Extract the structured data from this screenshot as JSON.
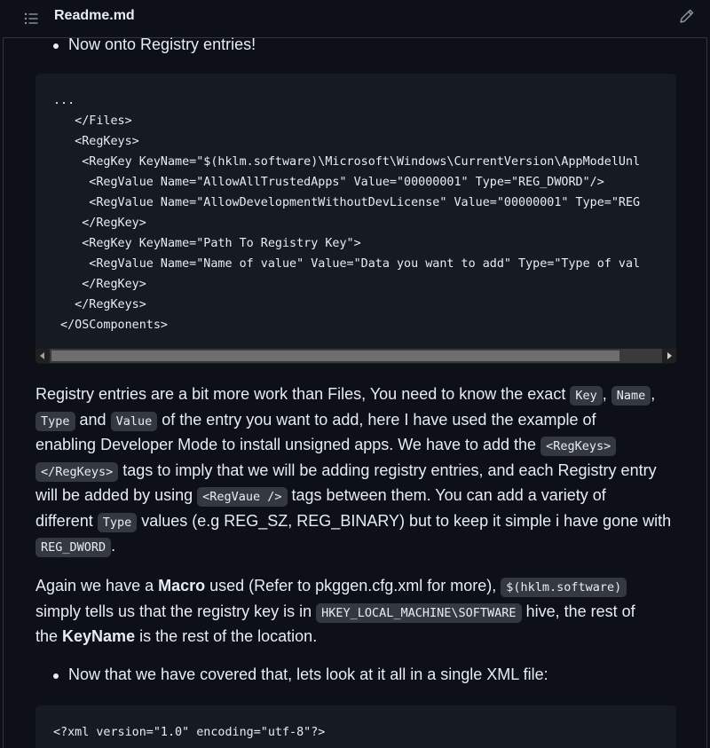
{
  "header": {
    "file_title": "Readme.md"
  },
  "bullet1": "Now onto Registry entries!",
  "code1": {
    "lines": [
      "...",
      "   </Files>",
      "   <RegKeys>",
      "    <RegKey KeyName=\"$(hklm.software)\\Microsoft\\Windows\\CurrentVersion\\AppModelUnl",
      "     <RegValue Name=\"AllowAllTrustedApps\" Value=\"00000001\" Type=\"REG_DWORD\"/>",
      "     <RegValue Name=\"AllowDevelopmentWithoutDevLicense\" Value=\"00000001\" Type=\"REG",
      "    </RegKey>",
      "    <RegKey KeyName=\"Path To Registry Key\">",
      "     <RegValue Name=\"Name of value\" Value=\"Data you want to add\" Type=\"Type of val",
      "    </RegKey>",
      "   </RegKeys>",
      " </OSComponents>"
    ]
  },
  "para1": {
    "l1a": "Registry entries are a bit more work than Files, You need to know the exact ",
    "c_key": "Key",
    "l1b": ",",
    "c_name": "Name",
    "l1c": ",",
    "c_type": "Type",
    "l2a": " and ",
    "c_value": "Value",
    "l2b": " of the entry you want to add, here I have used the example of",
    "l3a": "enabling Developer Mode to install unsigned apps. We have to add the ",
    "c_regkeys_open": "<RegKeys>",
    "c_regkeys_close": "</RegKeys>",
    "l4a": " tags to imply that we will be adding registry entries, and each Registry entry",
    "l5a": "will be added by using ",
    "c_regvaue": "<RegVaue />",
    "l5b": " tags between them. You can add a variety of",
    "l6a": "different ",
    "c_type2": "Type",
    "l6b": " values (e.g REG_SZ, REG_BINARY) but to keep it simple i have gone with",
    "c_reg_dword": "REG_DWORD",
    "l7a": "."
  },
  "para2": {
    "l1a": "Again we have a ",
    "b_macro": "Macro",
    "l1b": " used (Refer to pkggen.cfg.xml for more), ",
    "c_hklm": "$(hklm.software)",
    "l2a": "simply tells us that the registry key is in ",
    "c_hkey": "HKEY_LOCAL_MACHINE\\SOFTWARE",
    "l2b": " hive, the rest of",
    "l3a": "the ",
    "b_keyname": "KeyName",
    "l3b": " is the rest of the location."
  },
  "bullet2": "Now that we have covered that, lets look at it all in a single XML file:",
  "code2": {
    "lines": [
      "<?xml version=\"1.0\" encoding=\"utf-8\"?>"
    ]
  },
  "icons": [
    "list-icon",
    "pencil-icon"
  ],
  "colors": {
    "background": "#0d1117",
    "code_background": "#161b22",
    "inline_code_background": "#343941",
    "text": "#e6edf3",
    "border": "#30363d"
  }
}
